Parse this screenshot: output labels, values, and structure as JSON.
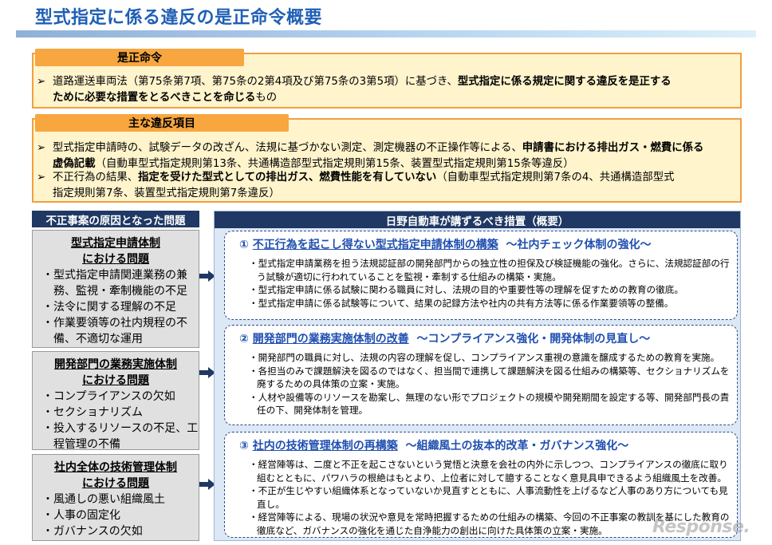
{
  "title": "型式指定に係る違反の是正命令概要",
  "order": {
    "tab": "是正命令",
    "marker": "➢",
    "t1": "道路運送車両法（第75条第7項、第75条の2第4項及び第75条の3第5項）に基づき、",
    "b1": "型式指定に係る規定に関する違反を是正する",
    "b2": "ために必要な措置をとるべきことを命じる",
    "t2": "もの"
  },
  "violations": {
    "tab": "主な違反項目",
    "marker": "➢",
    "i1_t1": "型式指定申請時の、試験データの改ざん、法規に基づかない測定、測定機器の不正操作等による、",
    "i1_b1": "申請書における排出ガス・燃費に係る",
    "i1_b2": "虚偽記載",
    "i1_t2": "（自動車型式指定規則第13条、共通構造部型式指定規則第15条、装置型式指定規則第15条等違反）",
    "i2_t1": "不正行為の結果、",
    "i2_b1": "指定を受けた型式としての排出ガス、燃費性能を有していない",
    "i2_t2": "（自動車型式指定規則第7条の4、共通構造部型式",
    "i2_t3": "指定規則第7条、装置型式指定規則第7条違反）"
  },
  "causes": {
    "header": "不正事案の原因となった問題",
    "box1": {
      "head1": "型式指定申請体制",
      "head2": "における問題",
      "items": [
        "・型式指定申請関連業務の兼務、監視・牽制機能の不足",
        "・法令に関する理解の不足",
        "・作業要領等の社内規程の不備、不適切な運用"
      ]
    },
    "box2": {
      "head1": "開発部門の業務実施体制",
      "head2": "における問題",
      "items": [
        "・コンプライアンスの欠如",
        "・セクショナリズム",
        "・投入するリソースの不足、工程管理の不備"
      ]
    },
    "box3": {
      "head1": "社内全体の技術管理体制",
      "head2": "における問題",
      "items": [
        "・風通しの悪い組織風土",
        "・人事の固定化",
        "・ガバナンスの欠如"
      ]
    }
  },
  "measures": {
    "header": "日野自動車が講ずるべき措置（概要）",
    "card1": {
      "num": "①",
      "title": "不正行為を起こし得ない型式指定申請体制の構築",
      "sub": "～社内チェック体制の強化～",
      "b1_a": "・型式指定申請業務を担う法規認証部の開発部門からの独立性の担保及び検証機能の強化。さらに、法規認証部の行う試験が適切に行われていることを監視・牽制する仕組みの構築・実施。",
      "b2": "・型式指定申請に係る試験に関わる職員に対し、法規の目的や重要性等の理解を促すための教育の徹底。",
      "b3": "・型式指定申請に係る試験等について、結果の記録方法や社内の共有方法等に係る作業要領等の整備。"
    },
    "card2": {
      "num": "②",
      "title": "開発部門の業務実施体制の改善",
      "sub": "～コンプライアンス強化・開発体制の見直し～",
      "b1": "・開発部門の職員に対し、法規の内容の理解を促し、コンプライアンス重視の意識を醸成するための教育を実施。",
      "b2": "・各担当のみで課題解決を図るのではなく、担当間で連携して課題解決を図る仕組みの構築等、セクショナリズムを廃するための具体策の立案・実施。",
      "b3": "・人材や設備等のリソースを勘案し、無理のない形でプロジェクトの規模や開発期間を設定する等、開発部門長の責任の下、開発体制を管理。"
    },
    "card3": {
      "num": "③",
      "title": "社内の技術管理体制の再構築",
      "sub": "～組織風土の抜本的改革・ガバナンス強化～",
      "b1": "・経営陣等は、二度と不正を起こさないという覚悟と決意を会社の内外に示しつつ、コンプライアンスの徹底に取り組むとともに、パワハラの根絶はもとより、上位者に対して臆することなく意見具申できるよう組織風土を改善。",
      "b2": "・不正が生じやすい組織体系となっていないか見直すとともに、人事流動性を上げるなど人事のあり方についても見直し。",
      "b3": "・経営陣等による、現場の状況や意見を常時把握するための仕組みの構築、今回の不正事案の教訓を基にした教育の徹底など、ガバナンスの強化を通じた自浄能力の創出に向けた具体策の立案・実施。"
    }
  },
  "watermark": "Response."
}
